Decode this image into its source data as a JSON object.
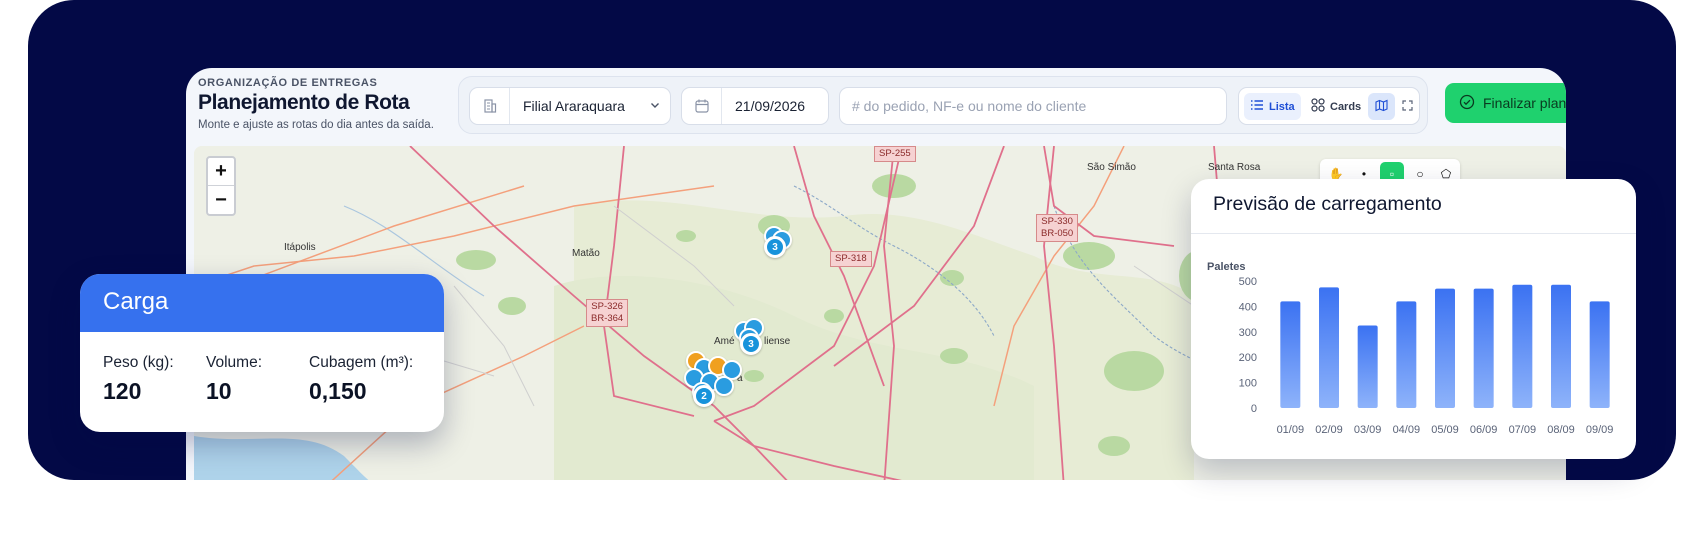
{
  "header": {
    "eyebrow": "ORGANIZAÇÃO DE ENTREGAS",
    "title": "Planejamento de Rota",
    "subtitle": "Monte e ajuste as rotas do dia antes da saída."
  },
  "toolbar": {
    "branch": "Filial Araraquara",
    "date": "21/09/2026",
    "search_placeholder": "# do pedido, NF-e ou nome do cliente",
    "view_list": "Lista",
    "view_cards": "Cards",
    "finalize": "Finalizar plane"
  },
  "map": {
    "zoom_in": "+",
    "zoom_out": "−",
    "labels": {
      "itapolis": "Itápolis",
      "matao": "Matão",
      "sao_simao": "São Simão",
      "santa_rosa": "Santa Rosa",
      "americo": "Amé",
      "liense": "liense",
      "fragment": "a"
    },
    "shields": {
      "sp318": "SP-318",
      "sp330": "SP-330",
      "br050": "BR-050",
      "sp326": "SP-326",
      "br364": "BR-364",
      "sp255": "SP-255"
    },
    "clusters": {
      "north": "3",
      "center": "3",
      "south": "2"
    }
  },
  "carga": {
    "title": "Carga",
    "peso_label": "Peso (kg):",
    "peso_value": "120",
    "volume_label": "Volume:",
    "volume_value": "10",
    "cubagem_label": "Cubagem (m³):",
    "cubagem_value": "0,150"
  },
  "previsao": {
    "title": "Previsão de carregamento"
  },
  "chart_data": {
    "type": "bar",
    "title": "Previsão de carregamento",
    "ylabel": "Paletes",
    "xlabel": "",
    "categories": [
      "01/09",
      "02/09",
      "03/09",
      "04/09",
      "05/09",
      "06/09",
      "07/09",
      "08/09",
      "09/09"
    ],
    "values": [
      420,
      475,
      325,
      420,
      470,
      470,
      485,
      485,
      420
    ],
    "ylim": [
      0,
      500
    ],
    "yticks": [
      0,
      100,
      200,
      300,
      400,
      500
    ],
    "grid": false,
    "color": "#3b72f2"
  },
  "colors": {
    "frame": "#030946",
    "accent": "#3671ee",
    "finalize": "#1fd16e",
    "cluster": "#1893db"
  }
}
